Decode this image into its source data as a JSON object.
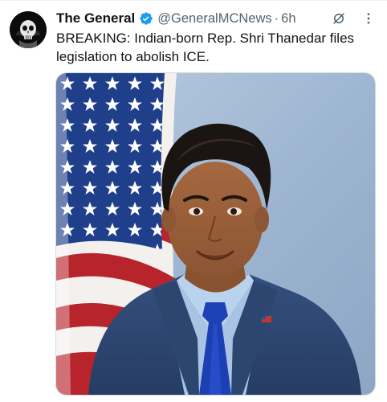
{
  "tweet": {
    "display_name": "The General",
    "handle": "@GeneralMCNews",
    "separator": "·",
    "time": "6h",
    "text": "BREAKING: Indian-born Rep. Shri Thanedar files legislation to abolish ICE.",
    "icons": {
      "avatar": "avatar-image",
      "verified": "verified-badge-icon",
      "grok": "grok-icon",
      "more": "more-options-icon"
    },
    "colors": {
      "verified": "#1d9bf0",
      "secondary_text": "#536471",
      "primary_text": "#0f1419"
    }
  }
}
